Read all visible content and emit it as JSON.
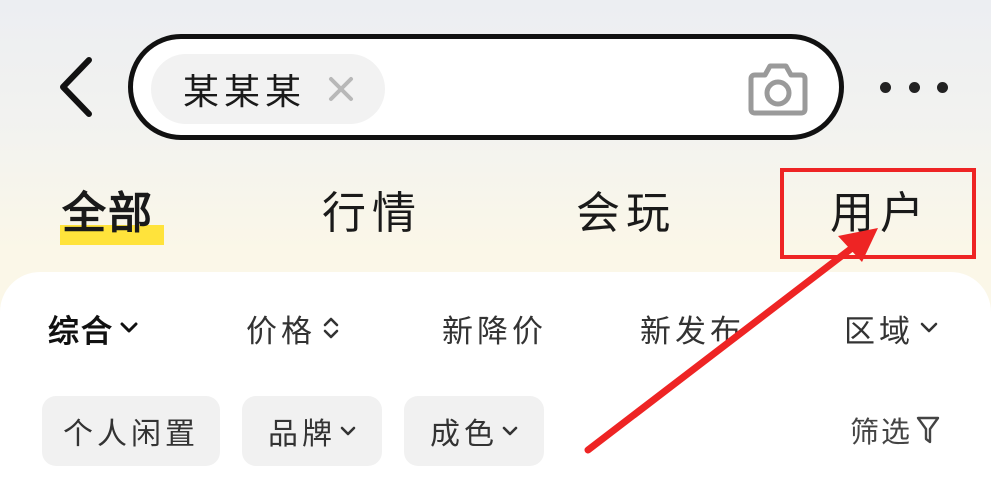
{
  "header": {
    "back_icon": "chevron-left-icon",
    "search": {
      "chip_text": "某某某",
      "clear_icon": "close-icon",
      "camera_icon": "camera-icon"
    },
    "more_icon": "more-horizontal-icon"
  },
  "tabs": [
    {
      "label": "全部",
      "active": true
    },
    {
      "label": "行情",
      "active": false
    },
    {
      "label": "会玩",
      "active": false
    },
    {
      "label": "用户",
      "active": false
    }
  ],
  "sort_bar": [
    {
      "label": "综合",
      "icon": "chevron-down-icon"
    },
    {
      "label": "价格",
      "icon": "sort-updown-icon"
    },
    {
      "label": "新降价"
    },
    {
      "label": "新发布"
    },
    {
      "label": "区域",
      "icon": "chevron-down-icon"
    }
  ],
  "filter_chips": [
    {
      "label": "个人闲置"
    },
    {
      "label": "品牌",
      "icon": "chevron-down-icon"
    },
    {
      "label": "成色",
      "icon": "chevron-down-icon"
    }
  ],
  "filter_button": {
    "label": "筛选",
    "icon": "funnel-icon"
  },
  "annotation": {
    "color": "#ee2424",
    "target": "用户"
  },
  "colors": {
    "accent_yellow": "#ffe33b",
    "annotation_red": "#ee2424"
  }
}
